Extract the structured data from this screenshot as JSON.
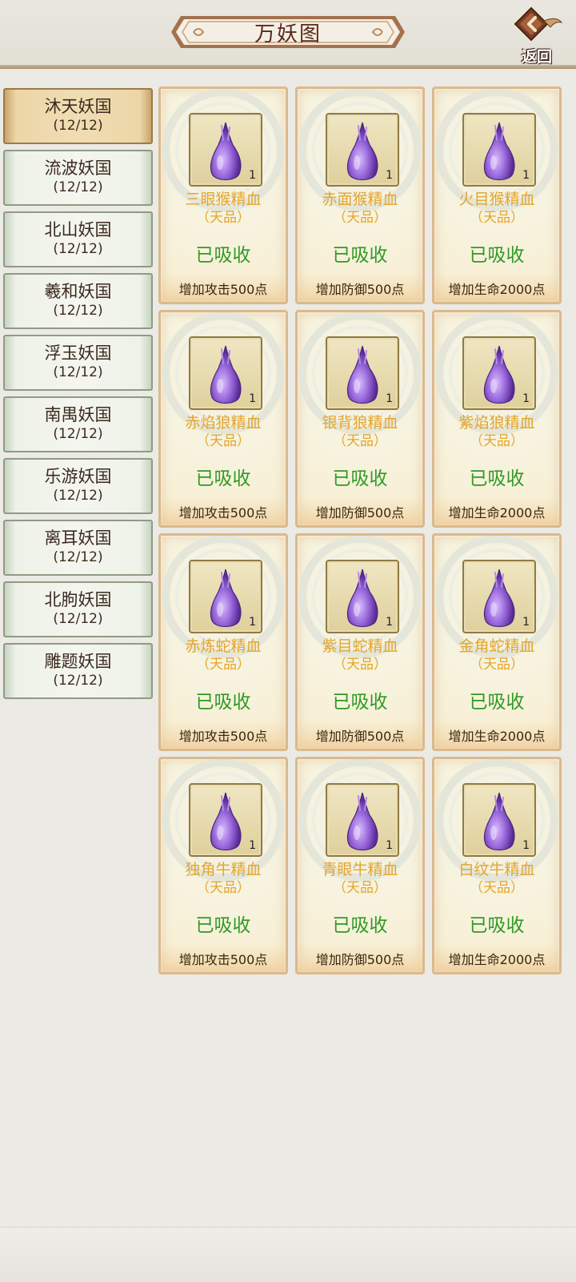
{
  "header": {
    "title": "万妖图",
    "back_label": "返回"
  },
  "sidebar": {
    "items": [
      {
        "name": "沐天妖国",
        "count": "(12/12)",
        "active": true
      },
      {
        "name": "流波妖国",
        "count": "(12/12)"
      },
      {
        "name": "北山妖国",
        "count": "(12/12)"
      },
      {
        "name": "羲和妖国",
        "count": "(12/12)"
      },
      {
        "name": "浮玉妖国",
        "count": "(12/12)"
      },
      {
        "name": "南禺妖国",
        "count": "(12/12)"
      },
      {
        "name": "乐游妖国",
        "count": "(12/12)"
      },
      {
        "name": "离耳妖国",
        "count": "(12/12)"
      },
      {
        "name": "北朐妖国",
        "count": "(12/12)"
      },
      {
        "name": "雕题妖国",
        "count": "(12/12)"
      }
    ]
  },
  "cards": [
    {
      "name": "三眼猴精血",
      "grade": "（天品）",
      "status": "已吸收",
      "bonus": "增加攻击500点",
      "count": "1"
    },
    {
      "name": "赤面猴精血",
      "grade": "（天品）",
      "status": "已吸收",
      "bonus": "增加防御500点",
      "count": "1"
    },
    {
      "name": "火目猴精血",
      "grade": "（天品）",
      "status": "已吸收",
      "bonus": "增加生命2000点",
      "count": "1"
    },
    {
      "name": "赤焰狼精血",
      "grade": "（天品）",
      "status": "已吸收",
      "bonus": "增加攻击500点",
      "count": "1"
    },
    {
      "name": "银背狼精血",
      "grade": "（天品）",
      "status": "已吸收",
      "bonus": "增加防御500点",
      "count": "1"
    },
    {
      "name": "紫焰狼精血",
      "grade": "（天品）",
      "status": "已吸收",
      "bonus": "增加生命2000点",
      "count": "1"
    },
    {
      "name": "赤炼蛇精血",
      "grade": "（天品）",
      "status": "已吸收",
      "bonus": "增加攻击500点",
      "count": "1"
    },
    {
      "name": "紫目蛇精血",
      "grade": "（天品）",
      "status": "已吸收",
      "bonus": "增加防御500点",
      "count": "1"
    },
    {
      "name": "金角蛇精血",
      "grade": "（天品）",
      "status": "已吸收",
      "bonus": "增加生命2000点",
      "count": "1"
    },
    {
      "name": "独角牛精血",
      "grade": "（天品）",
      "status": "已吸收",
      "bonus": "增加攻击500点",
      "count": "1"
    },
    {
      "name": "青眼牛精血",
      "grade": "（天品）",
      "status": "已吸收",
      "bonus": "增加防御500点",
      "count": "1"
    },
    {
      "name": "白纹牛精血",
      "grade": "（天品）",
      "status": "已吸收",
      "bonus": "增加生命2000点",
      "count": "1"
    }
  ],
  "icons": {
    "item": "purple-blood-drop-icon",
    "back": "back-arrow-icon"
  },
  "colors": {
    "name_text": "#e5a52a",
    "status_text": "#2f9a26",
    "active_tab": "#ecd6a8",
    "tab": "#eef2e8"
  }
}
